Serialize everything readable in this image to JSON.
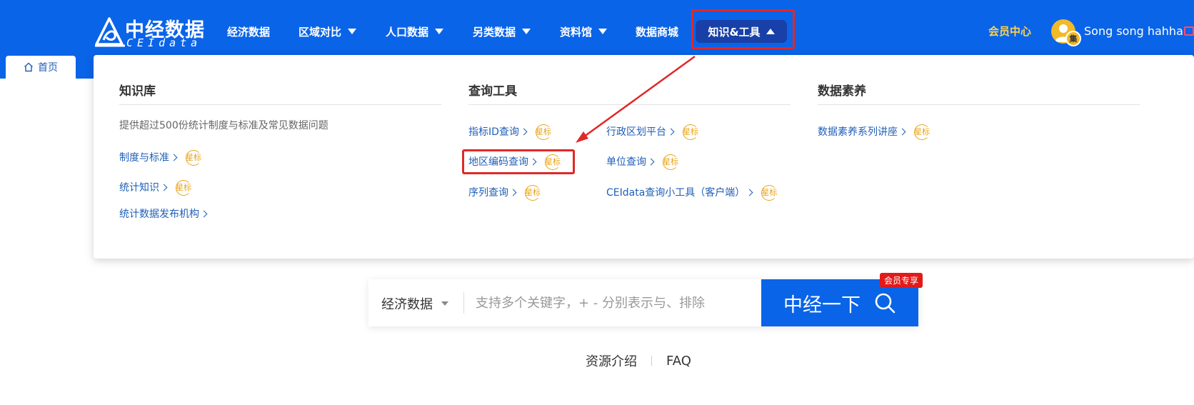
{
  "brand": {
    "name_cn": "中经数据",
    "name_en": "CEIdata"
  },
  "nav": {
    "items": [
      {
        "label": "经济数据",
        "dropdown": false
      },
      {
        "label": "区域对比",
        "dropdown": true
      },
      {
        "label": "人口数据",
        "dropdown": true
      },
      {
        "label": "另类数据",
        "dropdown": true
      },
      {
        "label": "资料馆",
        "dropdown": true
      },
      {
        "label": "数据商城",
        "dropdown": false
      }
    ],
    "active": {
      "label": "知识&工具"
    },
    "member_center": "会员中心",
    "username": "Song song hahha",
    "avatar_badge": "集"
  },
  "tabs": {
    "home": "首页"
  },
  "menu": {
    "knowledge": {
      "title": "知识库",
      "desc": "提供超过500份统计制度与标准及常见数据问题",
      "links": [
        {
          "label": "制度与标准",
          "star": "星标"
        },
        {
          "label": "统计知识",
          "star": "星标"
        },
        {
          "label": "统计数据发布机构"
        }
      ]
    },
    "tools": {
      "title": "查询工具",
      "links": [
        {
          "label": "指标ID查询",
          "star": "星标"
        },
        {
          "label": "行政区划平台",
          "star": "星标"
        },
        {
          "label": "地区编码查询",
          "star": "星标"
        },
        {
          "label": "单位查询",
          "star": "星标"
        },
        {
          "label": "序列查询",
          "star": "星标"
        },
        {
          "label": "CEIdata查询小工具（客户端）",
          "star": "星标"
        }
      ]
    },
    "literacy": {
      "title": "数据素养",
      "links": [
        {
          "label": "数据素养系列讲座",
          "star": "星标"
        }
      ]
    }
  },
  "search": {
    "category": "经济数据",
    "placeholder": "支持多个关键字，+ - 分别表示与、排除",
    "button": "中经一下",
    "vip_badge": "会员专享"
  },
  "footer": {
    "link1": "资源介绍",
    "link2": "FAQ"
  },
  "colors": {
    "primary": "#0a64e8",
    "active_nav": "#1840a8",
    "link": "#1f5fb8",
    "star": "#e8a317",
    "highlight": "#e02828",
    "member": "#ffd24d"
  }
}
